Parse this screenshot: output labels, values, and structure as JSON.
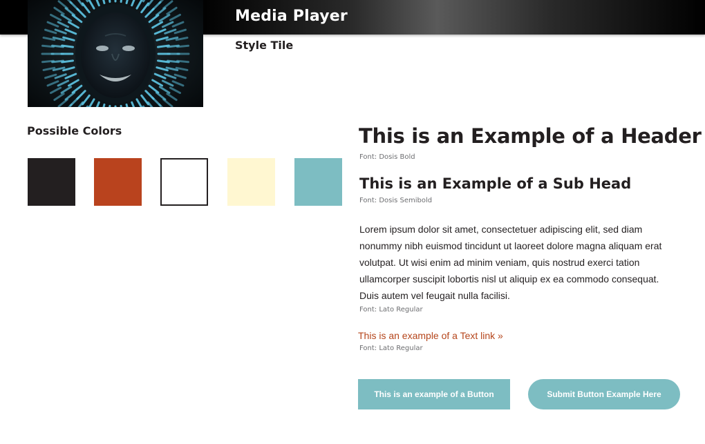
{
  "header": {
    "title": "Media Player"
  },
  "tile_label": "Style Tile",
  "colors": {
    "heading": "Possible Colors",
    "swatches": [
      {
        "hex": "#231f20"
      },
      {
        "hex": "#b9431e"
      },
      {
        "hex": "#ffffff"
      },
      {
        "hex": "#fff7d1"
      },
      {
        "hex": "#7dbdc2"
      }
    ]
  },
  "typography": {
    "header_example": "This is an Example of a Header",
    "header_font": "Font: Dosis Bold",
    "subhead_example": "This is an Example of a Sub Head",
    "subhead_font": "Font: Dosis Semibold",
    "body_example": "Lorem ipsum dolor sit amet, consectetuer adipiscing elit, sed diam nonummy nibh euismod tincidunt ut laoreet dolore magna aliquam erat volutpat. Ut wisi enim ad minim veniam, quis nostrud exerci tation ullamcorper suscipit lobortis nisl ut aliquip ex ea commodo consequat. Duis autem vel feugait nulla facilisi.",
    "body_font": "Font: Lato Regular",
    "link_example": "This is an example of a Text link »",
    "link_font": "Font: Lato Regular"
  },
  "buttons": {
    "square_label": "This is an example of a Button",
    "round_label": "Submit Button Example Here"
  },
  "accent_colors": {
    "link": "#b5451b",
    "button": "#7dbdc2",
    "album_ruffle": "#5fc7e6"
  }
}
